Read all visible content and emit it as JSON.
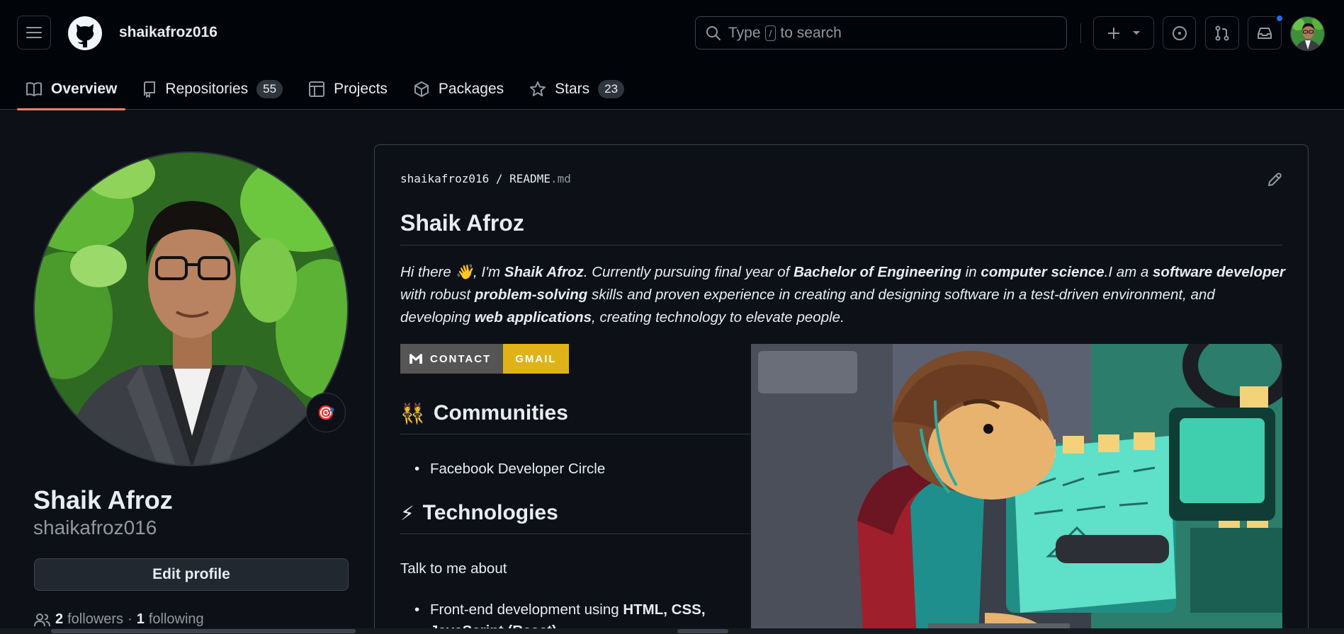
{
  "header": {
    "username": "shaikafroz016",
    "search_prefix": "Type",
    "search_slash": "/",
    "search_suffix": "to search"
  },
  "tabs": [
    {
      "label": "Overview",
      "active": true
    },
    {
      "label": "Repositories",
      "count": "55"
    },
    {
      "label": "Projects"
    },
    {
      "label": "Packages"
    },
    {
      "label": "Stars",
      "count": "23"
    }
  ],
  "profile": {
    "full_name": "Shaik Afroz",
    "login": "shaikafroz016",
    "status_emoji": "🎯",
    "edit_label": "Edit profile",
    "followers_count": "2",
    "followers_label": "followers",
    "separator": "·",
    "following_count": "1",
    "following_label": "following"
  },
  "readme": {
    "path_owner": "shaikafroz016",
    "path_sep": "/",
    "path_file": "README",
    "path_ext": ".md",
    "title": "Shaik Afroz",
    "intro": {
      "t1": "Hi there ",
      "wave": "👋",
      "t2": ", I'm ",
      "b1": "Shaik Afroz",
      "t3": ". Currently pursuing final year of ",
      "b2": "Bachelor of Engineering",
      "t4": " in ",
      "b3": "computer science",
      "t5": ".I am a ",
      "b4": "software developer",
      "t6": " with robust ",
      "b5": "problem-solving",
      "t7": " skills and proven experience in creating and designing software in a test-driven environment, and developing ",
      "b6": "web applications",
      "t8": ", creating technology to elevate people."
    },
    "badge_left": "CONTACT",
    "badge_right": "GMAIL",
    "communities_emoji": "👯",
    "communities_heading": "Communities",
    "communities_item": "Facebook Developer Circle",
    "tech_emoji": "⚡",
    "tech_heading": "Technologies",
    "talk_text": "Talk to me about",
    "frontend_text": "Front-end development using ",
    "frontend_bold": "HTML, CSS,",
    "frontend_line2": "JavaScript (React)"
  },
  "colors": {
    "accent_underline": "#f78166",
    "badge_yellow": "#dfb317",
    "notification_dot": "#1f6feb"
  }
}
